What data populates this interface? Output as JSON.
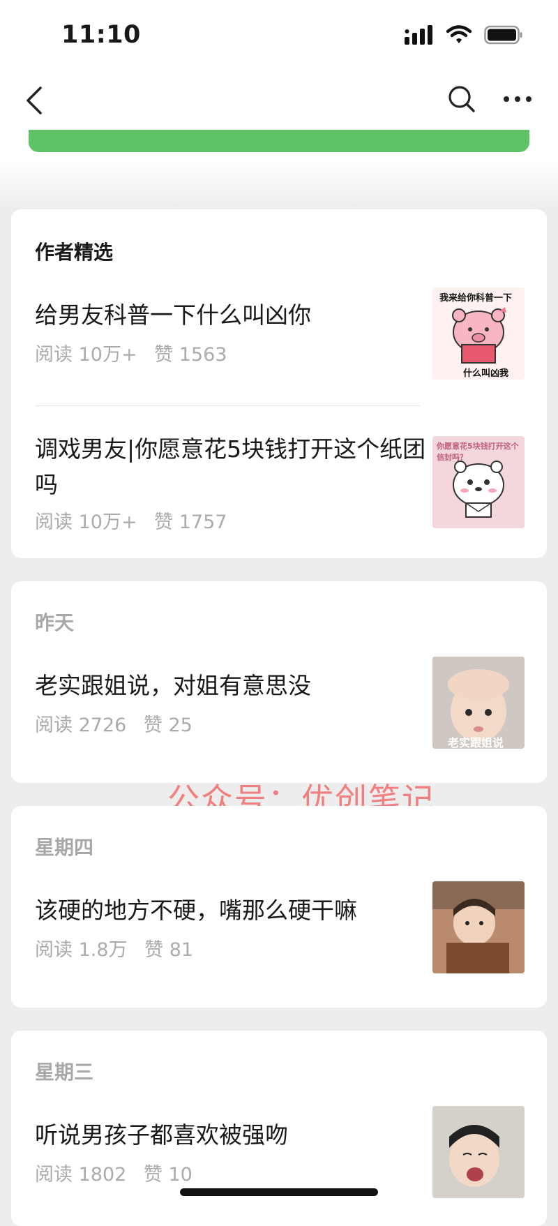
{
  "status": {
    "time": "11:10"
  },
  "nav": {
    "back": "back",
    "search": "search",
    "more": "more"
  },
  "cards": [
    {
      "title": "作者精选",
      "articles": [
        {
          "title": "给男友科普一下什么叫凶你",
          "reads": "阅读 10万+",
          "likes": "赞 1563",
          "thumb_caption_top": "我来给你科普一下",
          "thumb_caption_bottom": "什么叫凶我"
        },
        {
          "title": "调戏男友|你愿意花5块钱打开这个纸团吗",
          "reads": "阅读 10万+",
          "likes": "赞 1757",
          "thumb_caption_top": "你愿意花5块钱打开这个信封吗？"
        }
      ]
    },
    {
      "title": "昨天",
      "articles": [
        {
          "title": "老实跟姐说，对姐有意思没",
          "reads": "阅读 2726",
          "likes": "赞 25",
          "thumb_caption_bottom": "老实跟姐说"
        }
      ]
    },
    {
      "title": "星期四",
      "articles": [
        {
          "title": "该硬的地方不硬，嘴那么硬干嘛",
          "reads": "阅读 1.8万",
          "likes": "赞 81"
        }
      ]
    },
    {
      "title": "星期三",
      "articles": [
        {
          "title": "听说男孩子都喜欢被强吻",
          "reads": "阅读 1802",
          "likes": "赞 10"
        }
      ]
    }
  ],
  "watermark": "公众号：优创笔记",
  "colors": {
    "green": "#5fc267",
    "watermark": "#f08080",
    "meta": "#ababab"
  }
}
